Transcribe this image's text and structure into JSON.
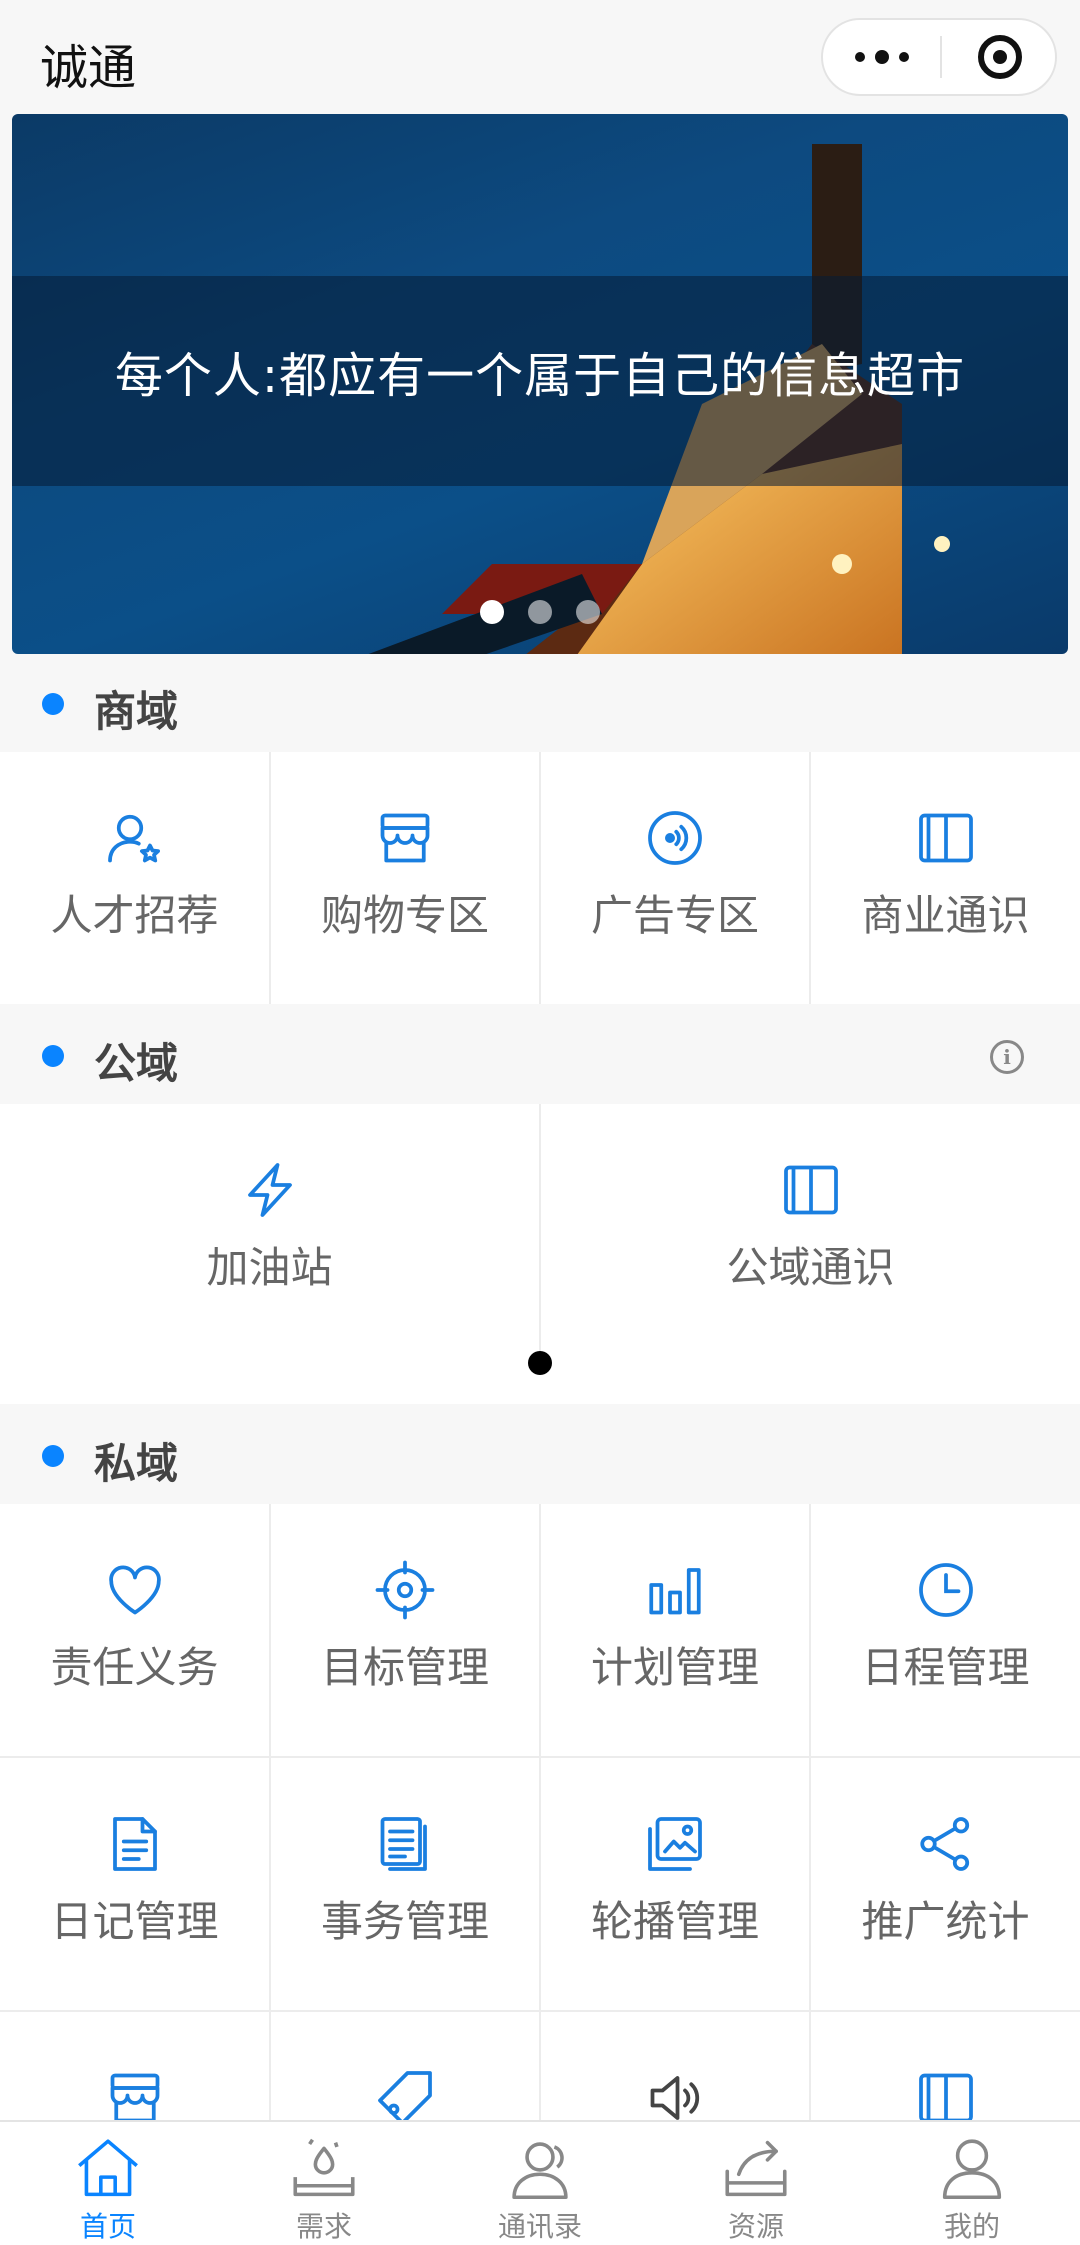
{
  "navbar": {
    "title": "诚通"
  },
  "banner": {
    "caption": "每个人:都应有一个属于自己的信息超市",
    "slide_count": 3,
    "active_slide": 1
  },
  "sections": {
    "commerce": {
      "title": "商域",
      "items": [
        {
          "label": "人才招荐",
          "icon": "user-star-icon"
        },
        {
          "label": "购物专区",
          "icon": "store-icon"
        },
        {
          "label": "广告专区",
          "icon": "broadcast-icon"
        },
        {
          "label": "商业通识",
          "icon": "book-icon"
        }
      ]
    },
    "public": {
      "title": "公域",
      "info_icon": "info-icon",
      "items": [
        {
          "label": "加油站",
          "icon": "lightning-icon"
        },
        {
          "label": "公域通识",
          "icon": "book-icon"
        }
      ]
    },
    "private": {
      "title": "私域",
      "items": [
        {
          "label": "责任义务",
          "icon": "heart-icon"
        },
        {
          "label": "目标管理",
          "icon": "target-icon"
        },
        {
          "label": "计划管理",
          "icon": "bar-chart-icon"
        },
        {
          "label": "日程管理",
          "icon": "clock-icon"
        },
        {
          "label": "日记管理",
          "icon": "document-icon"
        },
        {
          "label": "事务管理",
          "icon": "list-document-icon"
        },
        {
          "label": "轮播管理",
          "icon": "image-icon"
        },
        {
          "label": "推广统计",
          "icon": "share-icon"
        },
        {
          "label": "",
          "icon": "store-icon"
        },
        {
          "label": "",
          "icon": "tag-icon"
        },
        {
          "label": "",
          "icon": "speaker-icon"
        },
        {
          "label": "",
          "icon": "book-icon"
        }
      ]
    }
  },
  "tabbar": {
    "active_index": 0,
    "accent_color": "#0a84ff",
    "items": [
      {
        "label": "首页",
        "icon": "home-icon"
      },
      {
        "label": "需求",
        "icon": "demand-icon"
      },
      {
        "label": "通讯录",
        "icon": "contacts-icon"
      },
      {
        "label": "资源",
        "icon": "resource-icon"
      },
      {
        "label": "我的",
        "icon": "profile-icon"
      }
    ]
  }
}
